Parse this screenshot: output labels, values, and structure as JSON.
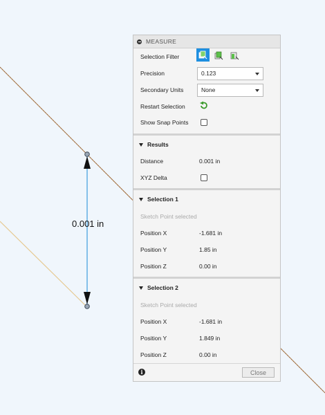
{
  "canvas": {
    "dimension_label": "0.001 in"
  },
  "panel": {
    "title": "MEASURE",
    "selection_filter_label": "Selection Filter",
    "precision_label": "Precision",
    "precision_value": "0.123",
    "secondary_units_label": "Secondary Units",
    "secondary_units_value": "None",
    "restart_selection_label": "Restart Selection",
    "show_snap_points_label": "Show Snap Points",
    "results": {
      "title": "Results",
      "distance_label": "Distance",
      "distance_value": "0.001 in",
      "xyz_delta_label": "XYZ Delta"
    },
    "selection1": {
      "title": "Selection 1",
      "subtitle": "Sketch Point selected",
      "pos_x_label": "Position X",
      "pos_x_value": "-1.681 in",
      "pos_y_label": "Position Y",
      "pos_y_value": "1.85 in",
      "pos_z_label": "Position Z",
      "pos_z_value": "0.00 in"
    },
    "selection2": {
      "title": "Selection 2",
      "subtitle": "Sketch Point selected",
      "pos_x_label": "Position X",
      "pos_x_value": "-1.681 in",
      "pos_y_label": "Position Y",
      "pos_y_value": "1.849 in",
      "pos_z_label": "Position Z",
      "pos_z_value": "0.00 in"
    },
    "close_label": "Close",
    "info_glyph": "i"
  },
  "colors": {
    "accent": "#1e8fe0",
    "dimension_line": "#4aa3e0",
    "sketch_line_dark": "#c08a5a",
    "sketch_line_light": "#e8cfa0"
  }
}
